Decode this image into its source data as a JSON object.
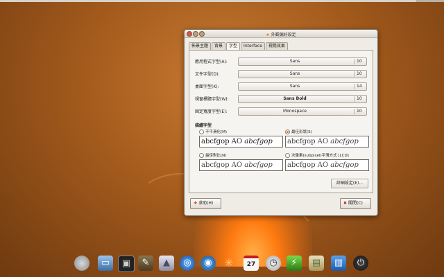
{
  "window": {
    "title": "外觀偏好設定"
  },
  "tabs": [
    {
      "label": "佈景主題"
    },
    {
      "label": "背景"
    },
    {
      "label": "字型"
    },
    {
      "label": "Interface"
    },
    {
      "label": "視覺效果"
    }
  ],
  "fonts": [
    {
      "label": "應用程式字型(A):",
      "font": "Sans",
      "size": "10",
      "bold": false
    },
    {
      "label": "文件字型(D):",
      "font": "Sans",
      "size": "10",
      "bold": false
    },
    {
      "label": "桌面字型(K):",
      "font": "Sans",
      "size": "14",
      "bold": false
    },
    {
      "label": "視窗標題字型(W):",
      "font": "Sans Bold",
      "size": "10",
      "bold": true
    },
    {
      "label": "固定寬度字型(E):",
      "font": "Monospace",
      "size": "10",
      "bold": false
    }
  ],
  "rendering": {
    "heading": "描繪字型",
    "sample_text": "abcfgop AO ",
    "sample_italic": "abcfgop",
    "options": [
      {
        "label": "不平滑化(M)",
        "selected": false
      },
      {
        "label": "最佳形狀(S)",
        "selected": true
      },
      {
        "label": "最佳對比(N)",
        "selected": false
      },
      {
        "label": "次像素(subpixel)平滑方式 [LCD]",
        "selected": false
      }
    ]
  },
  "buttons": {
    "details": "詳細設定(E)...",
    "help": "求助(H)",
    "close": "關閉(C)"
  },
  "dock": [
    "apple-icon",
    "computer-icon",
    "terminal-icon",
    "gimp-icon",
    "vlc-icon",
    "browser-icon",
    "globe-icon",
    "star-icon",
    "calendar-icon",
    "clock-icon",
    "battery-icon",
    "image-icon",
    "trash-icon",
    "power-icon"
  ],
  "dock_glyphs": [
    "",
    "▭",
    "▣",
    "✎",
    "▲",
    "◎",
    "◉",
    "✳",
    "",
    "◷",
    "⚡",
    "▤",
    "▥",
    "⏻"
  ],
  "calendar_day": "27"
}
